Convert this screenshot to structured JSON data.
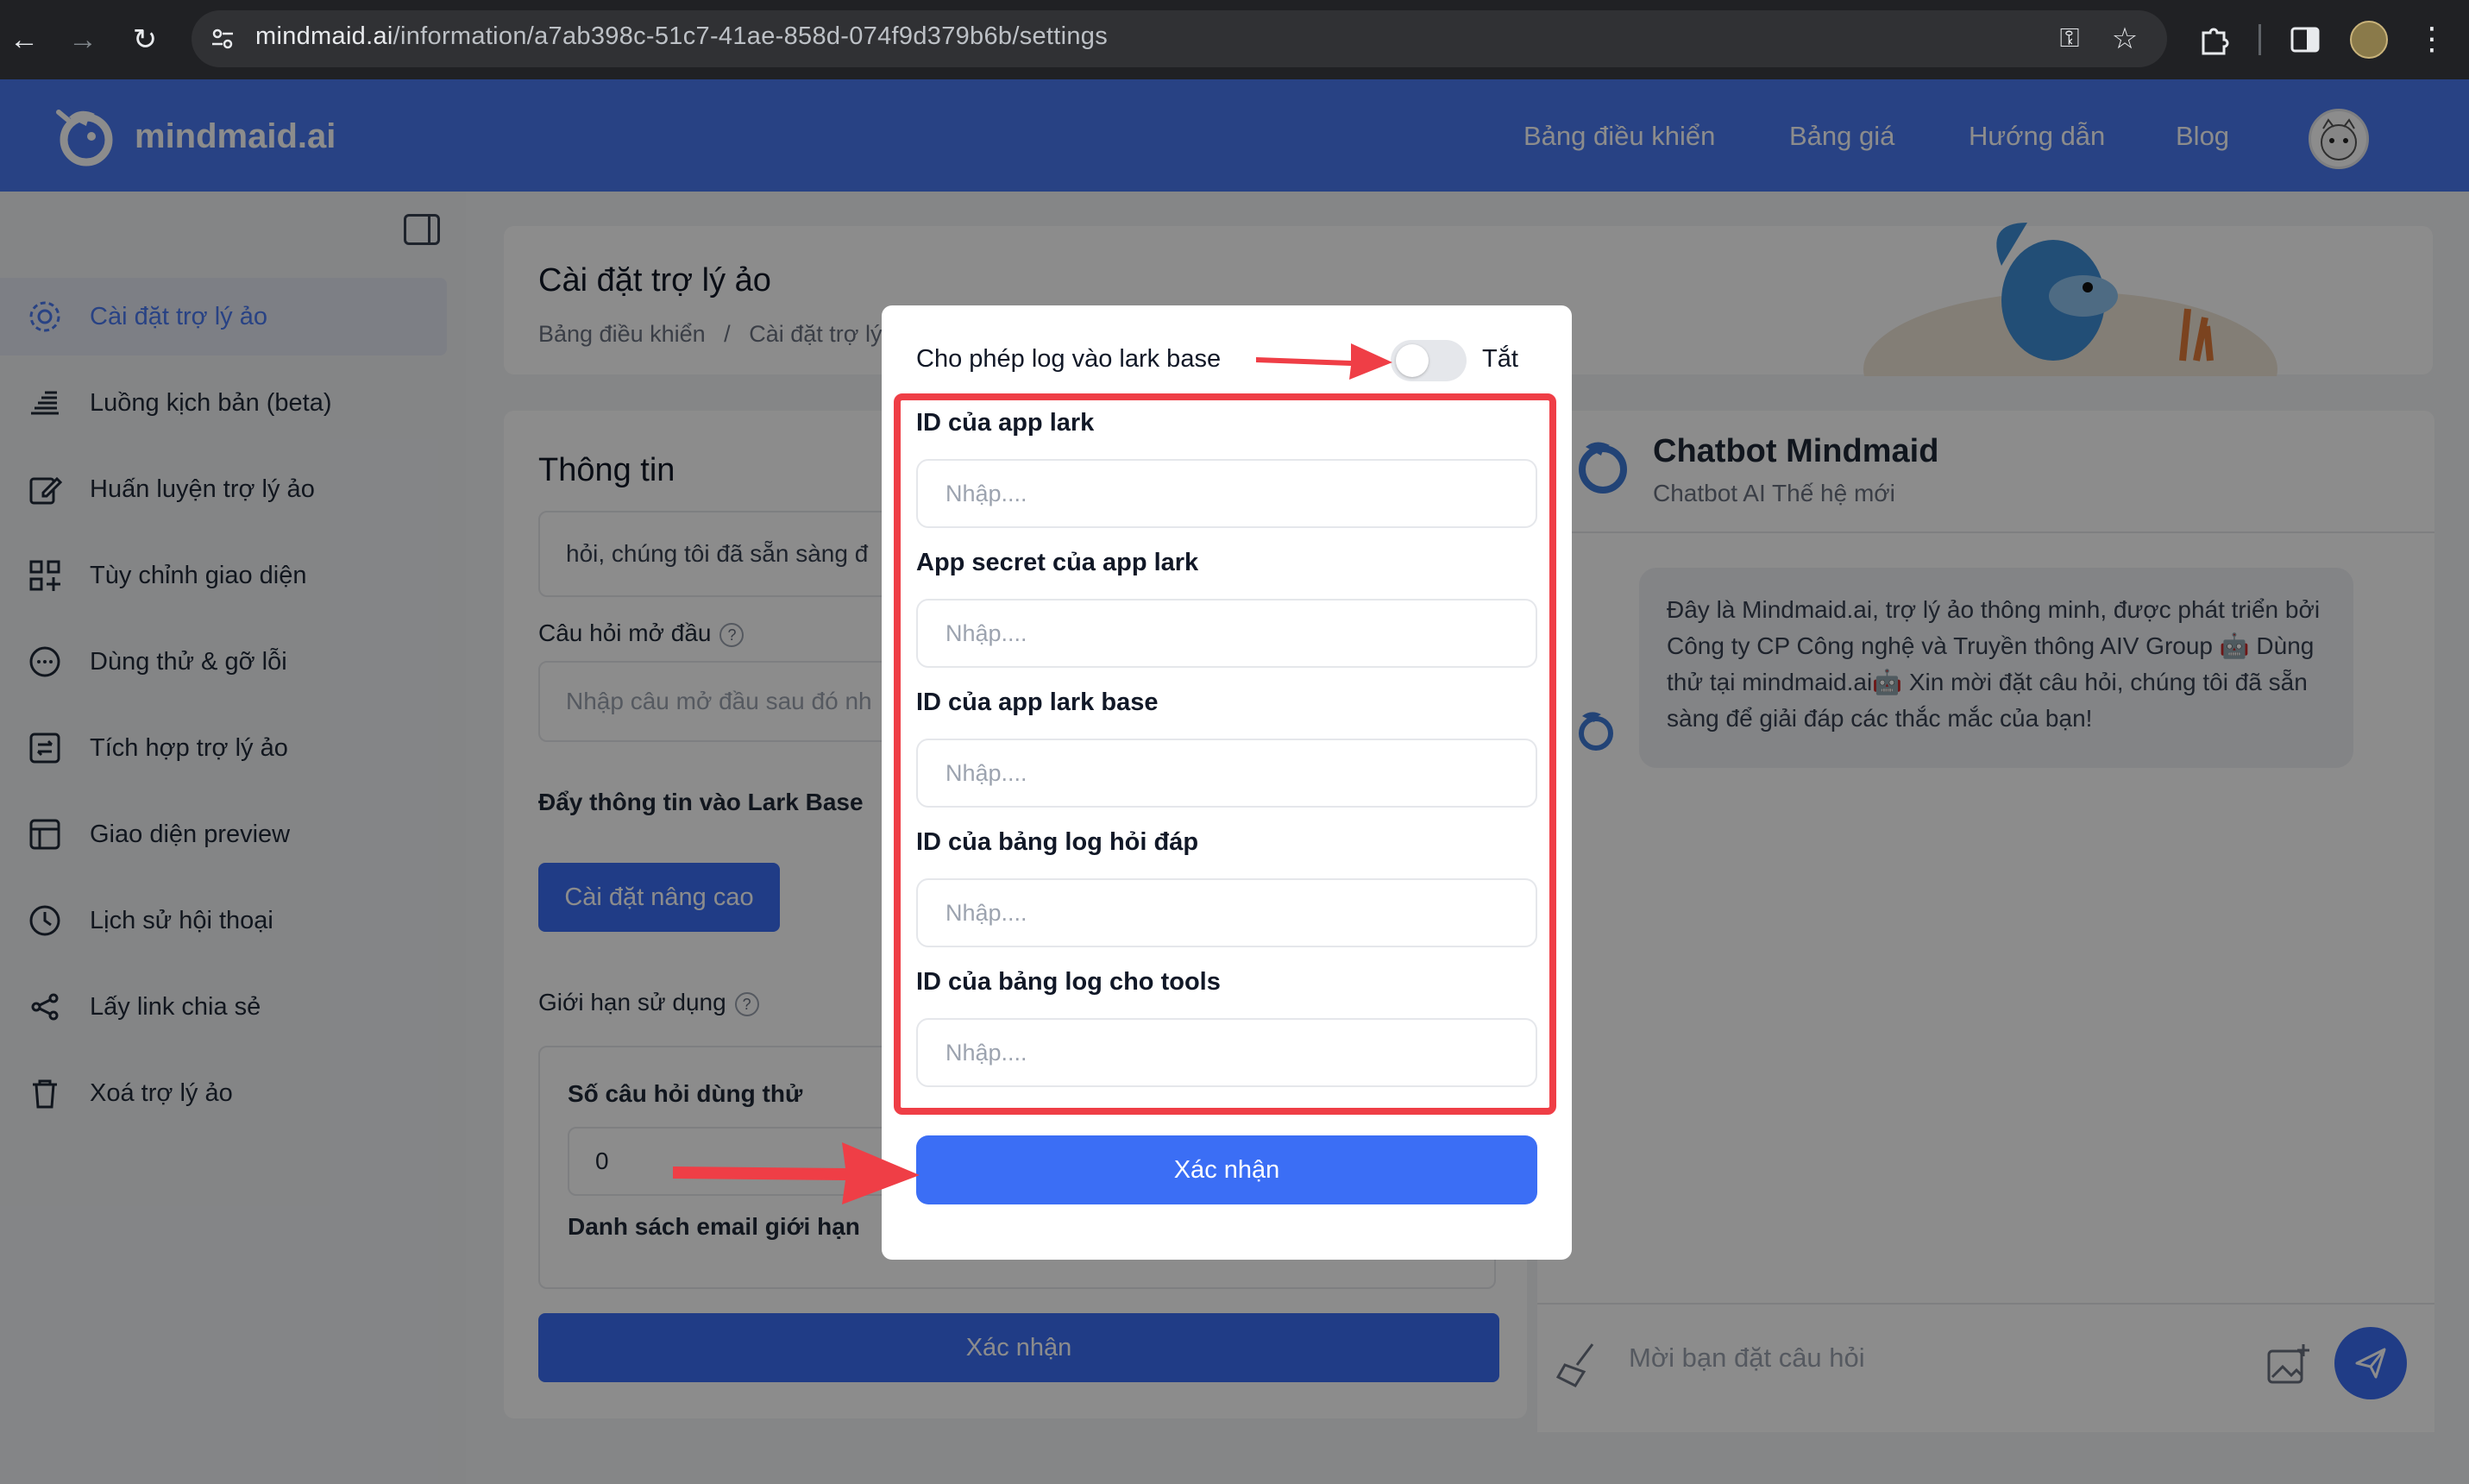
{
  "browser": {
    "url_host": "mindmaid.ai",
    "url_path": "/information/a7ab398c-51c7-41ae-858d-074f9d379b6b/settings"
  },
  "header": {
    "brand": "mindmaid.ai",
    "nav": [
      "Bảng điều khiển",
      "Bảng giá",
      "Hướng dẫn",
      "Blog"
    ],
    "accent_color": "#4a78f0"
  },
  "sidebar": {
    "items": [
      {
        "label": "Cài đặt trợ lý ảo",
        "icon": "gear-icon"
      },
      {
        "label": "Luồng kịch bản (beta)",
        "icon": "stack-icon"
      },
      {
        "label": "Huấn luyện trợ lý ảo",
        "icon": "edit-icon"
      },
      {
        "label": "Tùy chỉnh giao diện",
        "icon": "grid-plus-icon"
      },
      {
        "label": "Dùng thử & gỡ lỗi",
        "icon": "chat-bubble-icon"
      },
      {
        "label": "Tích hợp trợ lý ảo",
        "icon": "integration-icon"
      },
      {
        "label": "Giao diện preview",
        "icon": "layout-icon"
      },
      {
        "label": "Lịch sử hội thoại",
        "icon": "history-icon"
      },
      {
        "label": "Lấy link chia sẻ",
        "icon": "share-icon"
      },
      {
        "label": "Xoá trợ lý ảo",
        "icon": "trash-icon"
      }
    ]
  },
  "page": {
    "title": "Cài đặt trợ lý ảo",
    "breadcrumb_home": "Bảng điều khiển",
    "breadcrumb_sep": "/",
    "breadcrumb_current": "Cài đặt trợ lý",
    "section_title": "Thông tin",
    "intro_snippet": "hỏi, chúng tôi đã sẵn sàng đ",
    "opening_question_label": "Câu hỏi mở đầu",
    "opening_question_placeholder": "Nhập câu mở đầu sau đó nh",
    "lark_push_label": "Đẩy thông tin vào Lark Base",
    "advanced_button": "Cài đặt nâng cao",
    "usage_limit_label": "Giới hạn sử dụng",
    "trial_count_label": "Số câu hỏi dùng thử",
    "trial_count_value": "0",
    "email_limit_label": "Danh sách email giới hạn",
    "confirm_button": "Xác nhận"
  },
  "chat": {
    "name": "Chatbot Mindmaid",
    "subtitle": "Chatbot AI Thế hệ mới",
    "message": "Đây là Mindmaid.ai, trợ lý ảo thông minh, được phát triển bởi Công ty CP Công nghệ và Truyền thông AIV Group 🤖 Dùng thử tại mindmaid.ai🤖 Xin mời đặt câu hỏi, chúng tôi đã sẵn sàng để giải đáp các thắc mắc của bạn!",
    "input_placeholder": "Mời bạn đặt câu hỏi"
  },
  "modal": {
    "toggle_label": "Cho phép log vào lark base",
    "toggle_state": "Tắt",
    "toggle_on": false,
    "fields": [
      {
        "label": "ID của app lark",
        "placeholder": "Nhập...."
      },
      {
        "label": "App secret của app lark",
        "placeholder": "Nhập...."
      },
      {
        "label": "ID của app lark base",
        "placeholder": "Nhập...."
      },
      {
        "label": "ID của bảng log hỏi đáp",
        "placeholder": "Nhập...."
      },
      {
        "label": "ID của bảng log cho tools",
        "placeholder": "Nhập...."
      }
    ],
    "confirm_button": "Xác nhận",
    "highlight_color": "#ef3e46",
    "button_color": "#3b6ef5"
  }
}
